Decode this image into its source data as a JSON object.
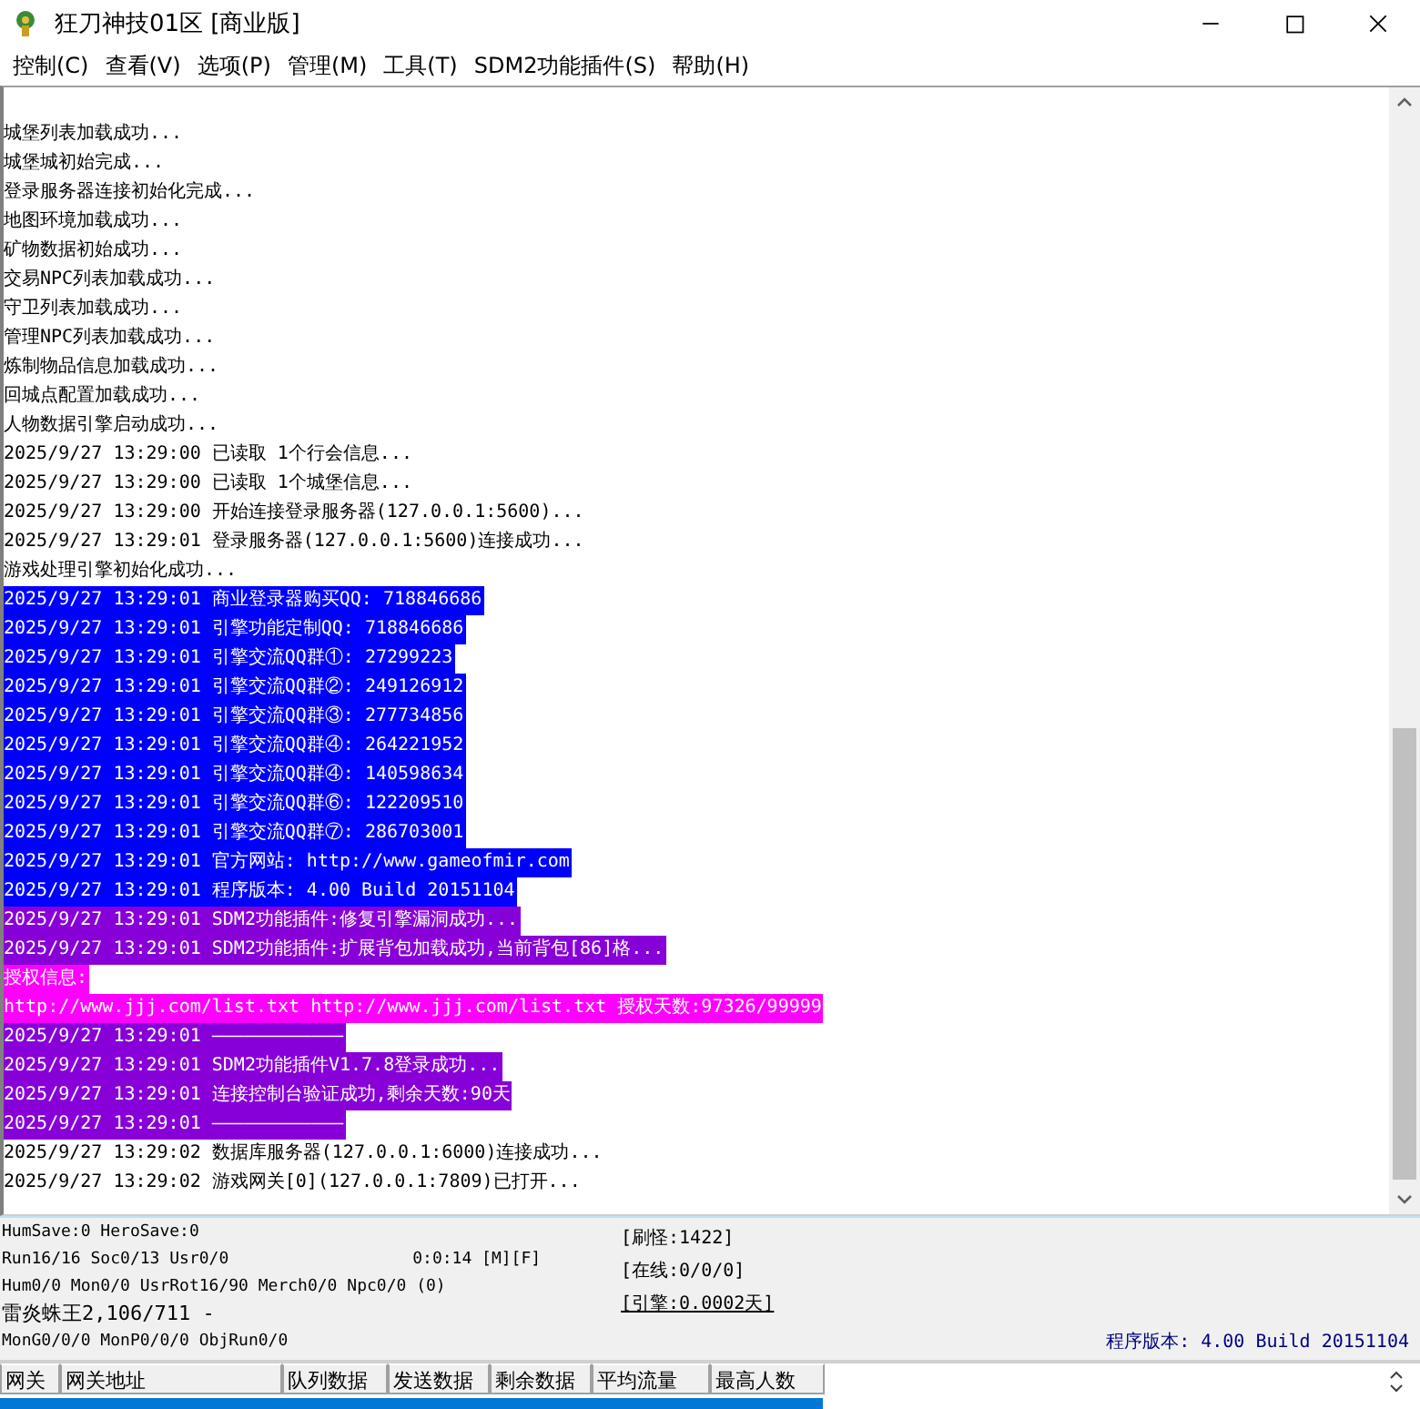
{
  "window": {
    "title": "狂刀神技01区 [商业版]"
  },
  "menu": [
    "控制(C)",
    "查看(V)",
    "选项(P)",
    "管理(M)",
    "工具(T)",
    "SDM2功能插件(S)",
    "帮助(H)"
  ],
  "log": [
    {
      "text": "城堡列表加载成功...",
      "kind": "plain"
    },
    {
      "text": "城堡城初始完成...",
      "kind": "plain"
    },
    {
      "text": "登录服务器连接初始化完成...",
      "kind": "plain"
    },
    {
      "text": "地图环境加载成功...",
      "kind": "plain"
    },
    {
      "text": "矿物数据初始成功...",
      "kind": "plain"
    },
    {
      "text": "交易NPC列表加载成功...",
      "kind": "plain"
    },
    {
      "text": "守卫列表加载成功...",
      "kind": "plain"
    },
    {
      "text": "管理NPC列表加载成功...",
      "kind": "plain"
    },
    {
      "text": "炼制物品信息加载成功...",
      "kind": "plain"
    },
    {
      "text": "回城点配置加载成功...",
      "kind": "plain"
    },
    {
      "text": "人物数据引擎启动成功...",
      "kind": "plain"
    },
    {
      "text": "2025/9/27 13:29:00 已读取 1个行会信息...",
      "kind": "plain"
    },
    {
      "text": "2025/9/27 13:29:00 已读取 1个城堡信息...",
      "kind": "plain"
    },
    {
      "text": "2025/9/27 13:29:00 开始连接登录服务器(127.0.0.1:5600)...",
      "kind": "plain"
    },
    {
      "text": "2025/9/27 13:29:01 登录服务器(127.0.0.1:5600)连接成功...",
      "kind": "plain"
    },
    {
      "text": "游戏处理引擎初始化成功...",
      "kind": "plain"
    },
    {
      "text": "2025/9/27 13:29:01 商业登录器购买QQ: 718846686",
      "kind": "blue"
    },
    {
      "text": "2025/9/27 13:29:01 引擎功能定制QQ: 718846686",
      "kind": "blue"
    },
    {
      "text": "2025/9/27 13:29:01 引擎交流QQ群①: 27299223",
      "kind": "blue"
    },
    {
      "text": "2025/9/27 13:29:01 引擎交流QQ群②: 249126912",
      "kind": "blue"
    },
    {
      "text": "2025/9/27 13:29:01 引擎交流QQ群③: 277734856",
      "kind": "blue"
    },
    {
      "text": "2025/9/27 13:29:01 引擎交流QQ群④: 264221952",
      "kind": "blue"
    },
    {
      "text": "2025/9/27 13:29:01 引擎交流QQ群④: 140598634",
      "kind": "blue"
    },
    {
      "text": "2025/9/27 13:29:01 引擎交流QQ群⑥: 122209510",
      "kind": "blue"
    },
    {
      "text": "2025/9/27 13:29:01 引擎交流QQ群⑦: 286703001",
      "kind": "blue"
    },
    {
      "text": "2025/9/27 13:29:01 官方网站: http://www.gameofmir.com",
      "kind": "blue"
    },
    {
      "text": "2025/9/27 13:29:01 程序版本: 4.00 Build 20151104",
      "kind": "blue"
    },
    {
      "text": "2025/9/27 13:29:01 SDM2功能插件:修复引擎漏洞成功...",
      "kind": "purple"
    },
    {
      "text": "2025/9/27 13:29:01 SDM2功能插件:扩展背包加载成功,当前背包[86]格...",
      "kind": "purple"
    },
    {
      "text": "授权信息:",
      "kind": "magenta"
    },
    {
      "text": "http://www.jjj.com/list.txt http://www.jjj.com/list.txt 授权天数:97326/99999",
      "kind": "magenta"
    },
    {
      "text": "2025/9/27 13:29:01 ————————————",
      "kind": "purple"
    },
    {
      "text": "2025/9/27 13:29:01 SDM2功能插件V1.7.8登录成功...",
      "kind": "purple"
    },
    {
      "text": "2025/9/27 13:29:01 连接控制台验证成功,剩余天数:90天",
      "kind": "purple"
    },
    {
      "text": "2025/9/27 13:29:01 ————————————",
      "kind": "purple"
    },
    {
      "text": "2025/9/27 13:29:02 数据库服务器(127.0.0.1:6000)连接成功...",
      "kind": "plain"
    },
    {
      "text": "2025/9/27 13:29:02 游戏网关[0](127.0.0.1:7809)已打开...",
      "kind": "plain"
    }
  ],
  "status": {
    "left": [
      "HumSave:0 HeroSave:0",
      "Run16/16 Soc0/13 Usr0/0",
      "Hum0/0 Mon0/0 UsrRot16/90 Merch0/0 Npc0/0 (0)",
      "雷炎蛛王2,106/711 -",
      "MonG0/0/0 MonP0/0/0 ObjRun0/0"
    ],
    "timer": "0:0:14 [M][F]",
    "middle": [
      "[刷怪:1422]",
      "[在线:0/0/0]",
      "[引擎:0.0002天]"
    ],
    "version": "程序版本: 4.00 Build 20151104"
  },
  "gateway_table": {
    "columns": [
      "网关",
      "网关地址",
      "队列数据",
      "发送数据",
      "剩余数据",
      "平均流量",
      "最高人数"
    ]
  }
}
